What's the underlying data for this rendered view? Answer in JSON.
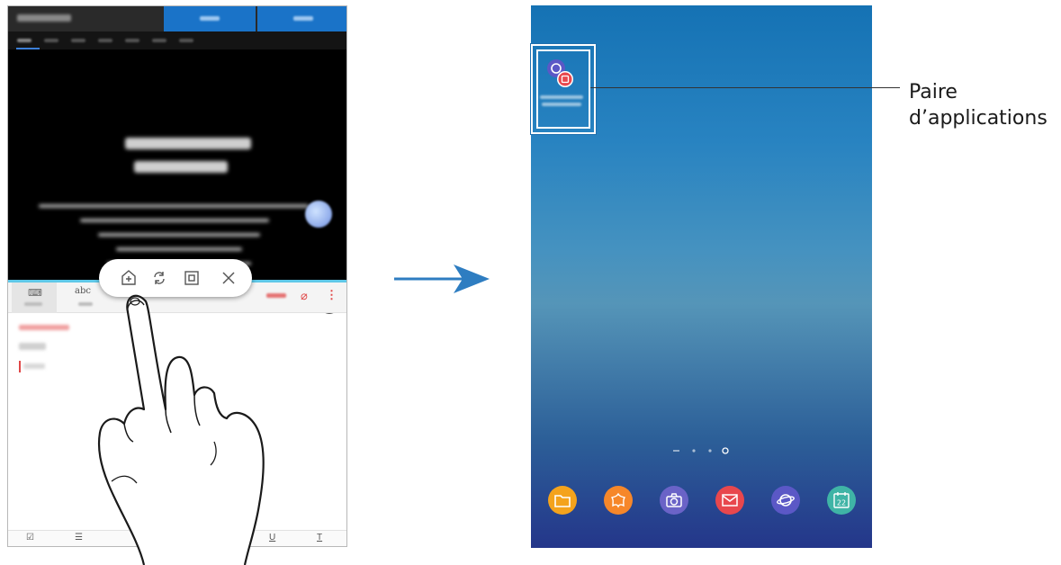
{
  "left_screen": {
    "notes_toolbar": {
      "handwriting_label": "abc"
    },
    "popup_toolbar": {
      "icons": [
        "add-app-pair-icon",
        "swap-windows-icon",
        "pop-up-view-icon",
        "close-icon"
      ]
    },
    "bottom_bar": {
      "underline_label": "U",
      "text_style_label": "T"
    },
    "scroll_up_glyph": "↑"
  },
  "right_screen": {
    "dock": {
      "apps": [
        {
          "icon": "folder-icon",
          "color": "#f4a31c"
        },
        {
          "icon": "gallery-icon",
          "color": "#f6872a"
        },
        {
          "icon": "camera-icon",
          "color": "#6a63c7"
        },
        {
          "icon": "email-icon",
          "color": "#e8474d"
        },
        {
          "icon": "internet-icon",
          "color": "#5b58c6"
        },
        {
          "icon": "calendar-icon",
          "color": "#3fb4a6",
          "text": "22"
        }
      ]
    },
    "page_indicator": {
      "pages": 4,
      "current": 4
    }
  },
  "callout": {
    "line1": "Paire",
    "line2": "d’applications"
  },
  "colors": {
    "arrow": "#2e7dc1",
    "accent_blue": "#1a73c8"
  }
}
